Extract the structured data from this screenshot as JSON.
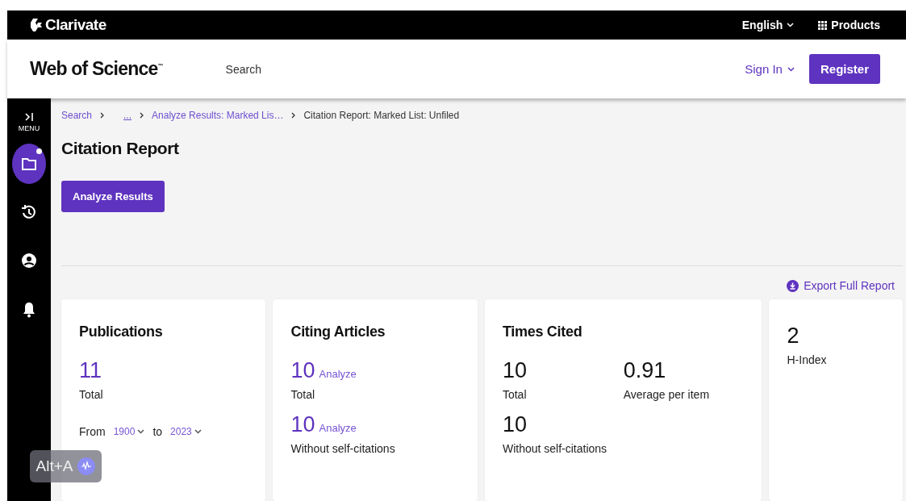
{
  "top_bar": {
    "brand": "Clarivate",
    "language": "English",
    "products": "Products"
  },
  "header": {
    "logo": "Web of Science",
    "logo_mark": "™",
    "nav": [
      "Search"
    ],
    "sign_in": "Sign In",
    "register": "Register"
  },
  "sidebar": {
    "menu_label": "MENU",
    "items": [
      {
        "kind": "folder",
        "selected": true,
        "badge": true
      },
      {
        "kind": "history",
        "selected": false,
        "badge": false
      },
      {
        "kind": "account",
        "selected": false,
        "badge": false
      },
      {
        "kind": "bell",
        "selected": false,
        "badge": false
      }
    ]
  },
  "breadcrumbs": [
    {
      "label": "Search",
      "kind": "link"
    },
    {
      "label": "...",
      "kind": "ellipsis"
    },
    {
      "label": "Analyze Results: Marked Lis…",
      "kind": "link"
    },
    {
      "label": "Citation Report: Marked List: Unfiled",
      "kind": "current"
    }
  ],
  "title": "Citation Report",
  "analyze_button": "Analyze Results",
  "export_link": "Export Full Report",
  "cards": [
    {
      "title": "Publications",
      "kind": "single",
      "metrics": [
        {
          "value": "11",
          "label": "Total",
          "linked": true
        }
      ],
      "range": {
        "from_label": "From",
        "from": "1900",
        "to_label": "to",
        "to": "2023"
      }
    },
    {
      "title": "Citing Articles",
      "kind": "single",
      "metrics": [
        {
          "value": "10",
          "label": "Total",
          "linked": true,
          "action": "Analyze"
        },
        {
          "value": "10",
          "label": "Without self-citations",
          "linked": true,
          "action": "Analyze"
        }
      ]
    },
    {
      "title": "Times Cited",
      "kind": "double",
      "metrics": [
        {
          "value": "10",
          "label": "Total",
          "linked": false
        },
        {
          "value": "0.91",
          "label": "Average per item",
          "linked": false
        },
        {
          "value": "10",
          "label": "Without self-citations",
          "linked": false
        }
      ]
    },
    {
      "kind": "narrow",
      "metrics": [
        {
          "value": "2",
          "label": "H-Index",
          "linked": false
        }
      ]
    }
  ],
  "shortcut_badge": {
    "label": "Alt+A"
  }
}
